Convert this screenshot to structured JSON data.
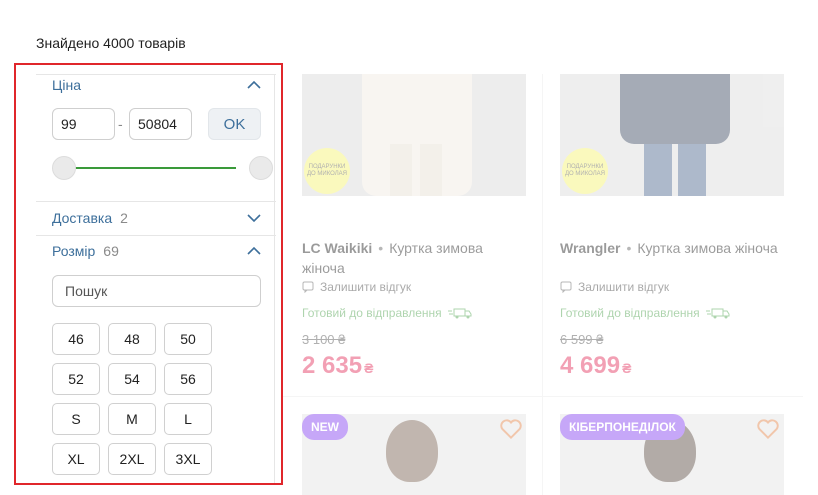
{
  "results": {
    "found_text": "Знайдено 4000 товарів"
  },
  "filters": {
    "price": {
      "title": "Ціна",
      "min_value": "99",
      "max_value": "50804",
      "separator": "-",
      "ok_label": "OK",
      "range_min_fraction": 0,
      "range_max_fraction": 1
    },
    "delivery": {
      "title": "Доставка",
      "count": "2"
    },
    "size": {
      "title": "Розмір",
      "count": "69",
      "search_placeholder": "Пошук",
      "options": [
        "46",
        "48",
        "50",
        "52",
        "54",
        "56",
        "S",
        "M",
        "L",
        "XL",
        "2XL",
        "3XL"
      ]
    }
  },
  "products": [
    {
      "brand": "LC Waikiki",
      "name": "Куртка зимова жіноча",
      "sticker": "ПОДАРУНКИ ДО МИКОЛАЯ",
      "review_label": "Залишити відгук",
      "shipping": "Готовий до відправлення",
      "old_price": "3 100 ₴",
      "new_price": "2 635",
      "currency": "₴",
      "image_color": "#efe8e0"
    },
    {
      "brand": "Wrangler",
      "name": "Куртка зимова жіноча",
      "sticker": "ПОДАРУНКИ ДО МИКОЛАЯ",
      "review_label": "Залишити відгук",
      "shipping": "Готовий до відправлення",
      "old_price": "6 599 ₴",
      "new_price": "4 699",
      "currency": "₴",
      "image_color": "#2c3a52"
    },
    {
      "badge": "NEW"
    },
    {
      "badge": "КІБЕРПОНЕДІЛОК"
    }
  ],
  "icons": {
    "review": "comment-icon",
    "shipping": "truck-icon",
    "wishlist": "heart-icon",
    "collapse": "chevron-up-icon",
    "expand": "chevron-down-icon"
  },
  "colors": {
    "highlight_frame": "#e0262b",
    "link_blue": "#3d6f9b",
    "price_red": "#e2204f",
    "ship_green": "#3f9a3f",
    "badge_purple": "#7a2ff0"
  }
}
